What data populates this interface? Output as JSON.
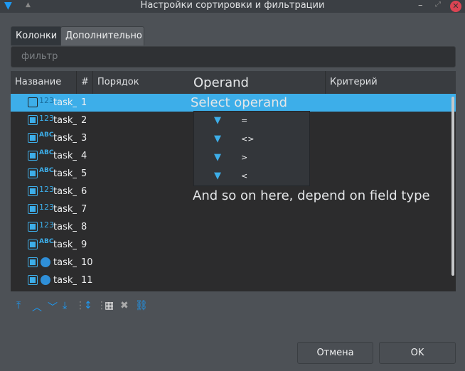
{
  "window": {
    "title": "Настройки сортировки и фильтрации"
  },
  "tabs": [
    {
      "label": "Колонки",
      "active": true
    },
    {
      "label": "Дополнительно",
      "active": false
    }
  ],
  "filter": {
    "placeholder": "фильтр",
    "value": ""
  },
  "table": {
    "headers": [
      "Название",
      "#",
      "Порядок",
      "Критерий"
    ],
    "rows": [
      {
        "type": "123",
        "name": "task_i",
        "num": "1",
        "checked": false,
        "selected": true
      },
      {
        "type": "123",
        "name": "task_p",
        "num": "2",
        "checked": true
      },
      {
        "type": "ABC",
        "name": "task_t",
        "num": "3",
        "checked": true
      },
      {
        "type": "ABC",
        "name": "task_v",
        "num": "4",
        "checked": true
      },
      {
        "type": "ABC",
        "name": "task_d",
        "num": "5",
        "checked": true
      },
      {
        "type": "123",
        "name": "task_p",
        "num": "6",
        "checked": true
      },
      {
        "type": "123",
        "name": "task_v",
        "num": "7",
        "checked": true
      },
      {
        "type": "123",
        "name": "task_s",
        "num": "8",
        "checked": true
      },
      {
        "type": "ABC",
        "name": "task_n",
        "num": "9",
        "checked": true
      },
      {
        "type": "clock",
        "name": "task_s",
        "num": "10",
        "checked": true
      },
      {
        "type": "clock",
        "name": "task_c",
        "num": "11",
        "checked": true
      }
    ]
  },
  "annotations": {
    "header": "Operand",
    "select": "Select operand",
    "note": "And so on here, depend on field type"
  },
  "operands": [
    "=",
    "<>",
    ">",
    "<"
  ],
  "buttons": {
    "cancel": "Отмена",
    "ok": "OK"
  },
  "colors": {
    "accent": "#3daee9"
  }
}
